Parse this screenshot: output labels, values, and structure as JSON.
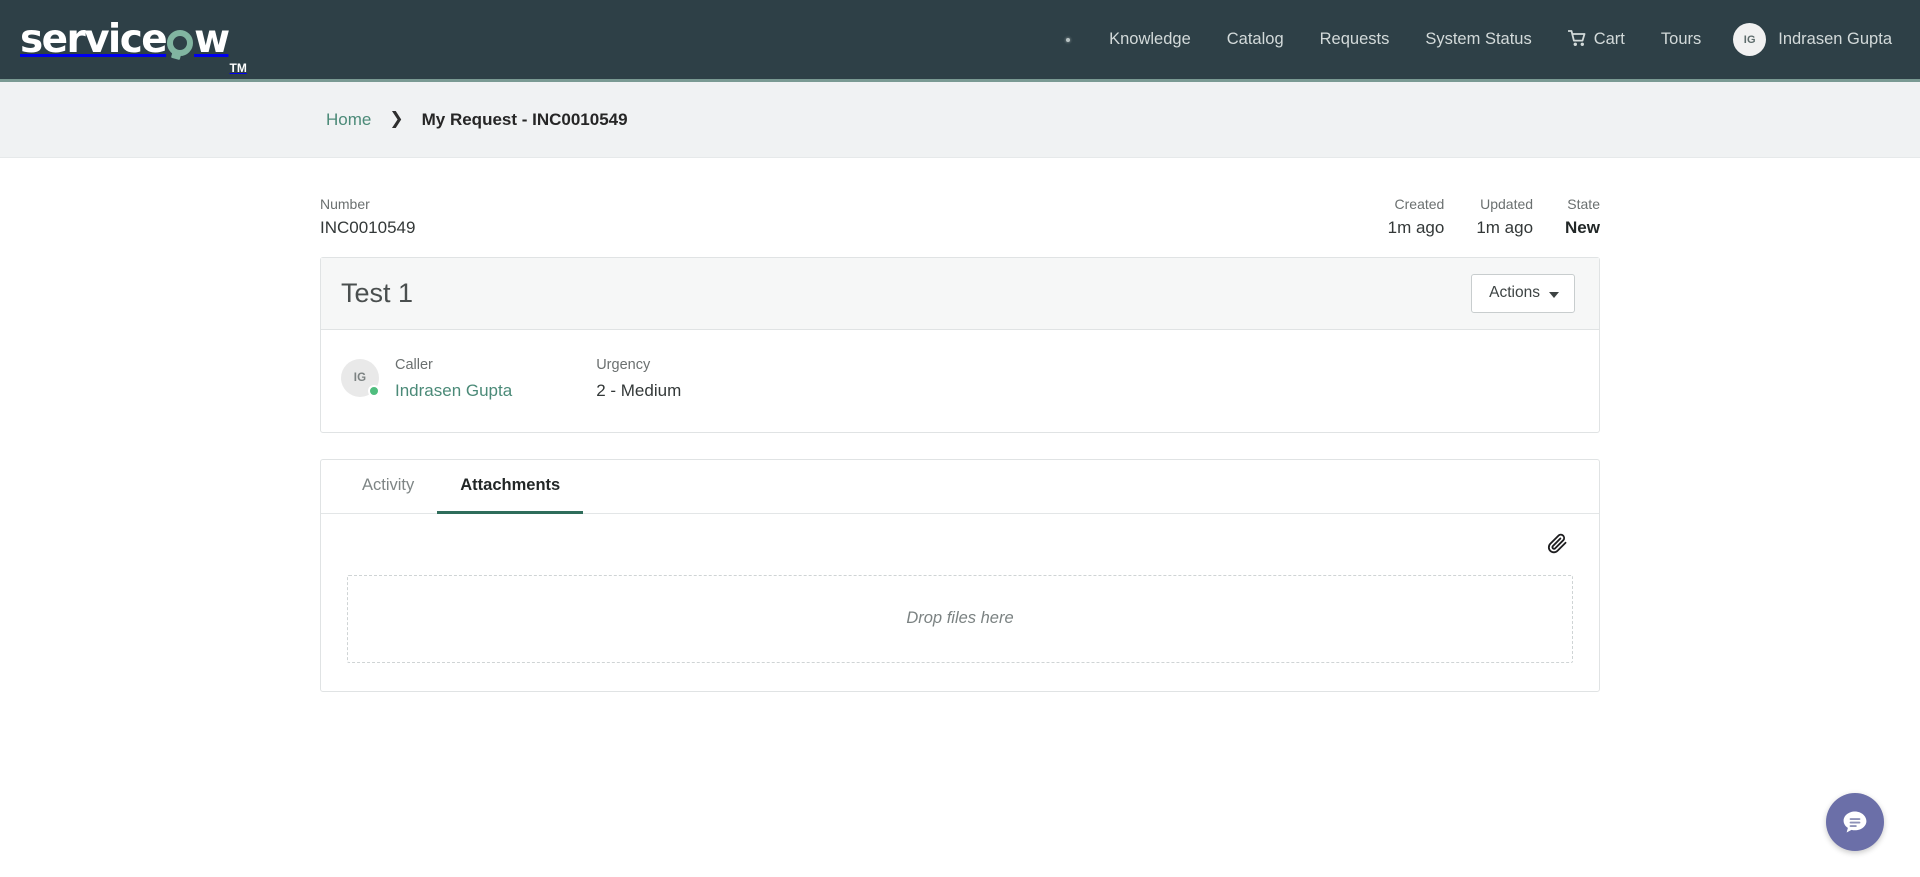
{
  "navbar": {
    "brand": {
      "lead": "service",
      "tail": "w",
      "trademark": "TM",
      "full_text": "servicenow"
    },
    "search_icon": "search-dot-icon",
    "links": [
      {
        "label": "Knowledge",
        "name": "nav-knowledge"
      },
      {
        "label": "Catalog",
        "name": "nav-catalog"
      },
      {
        "label": "Requests",
        "name": "nav-requests"
      },
      {
        "label": "System Status",
        "name": "nav-system-status"
      }
    ],
    "cart": {
      "label": "Cart",
      "icon": "shopping-cart-icon"
    },
    "tours": {
      "label": "Tours"
    },
    "user": {
      "initials": "IG",
      "name": "Indrasen Gupta"
    },
    "colors": {
      "background": "#2e4047",
      "accent_rule": "#7a9a93",
      "link": "#d3dada"
    }
  },
  "breadcrumb": {
    "home": "Home",
    "separator": "❯",
    "current": "My Request - INC0010549"
  },
  "record_meta": {
    "number_label": "Number",
    "number_value": "INC0010549",
    "created_label": "Created",
    "created_value": "1m ago",
    "updated_label": "Updated",
    "updated_value": "1m ago",
    "state_label": "State",
    "state_value": "New"
  },
  "ticket_card": {
    "title": "Test 1",
    "actions_button": "Actions",
    "caller": {
      "label": "Caller",
      "value": "Indrasen Gupta",
      "initials": "IG",
      "presence": "online",
      "presence_color": "#4fbd7e"
    },
    "urgency": {
      "label": "Urgency",
      "value": "2 - Medium"
    }
  },
  "tabs_card": {
    "tabs": [
      {
        "label": "Activity",
        "active": false,
        "name": "tab-activity"
      },
      {
        "label": "Attachments",
        "active": true,
        "name": "tab-attachments"
      }
    ],
    "active_underline_color": "#2f6d5b",
    "attach_icon": "paperclip-icon",
    "dropzone_text": "Drop files here"
  },
  "chat": {
    "icon": "chat-bubble-icon",
    "color": "#6b6fa8"
  }
}
